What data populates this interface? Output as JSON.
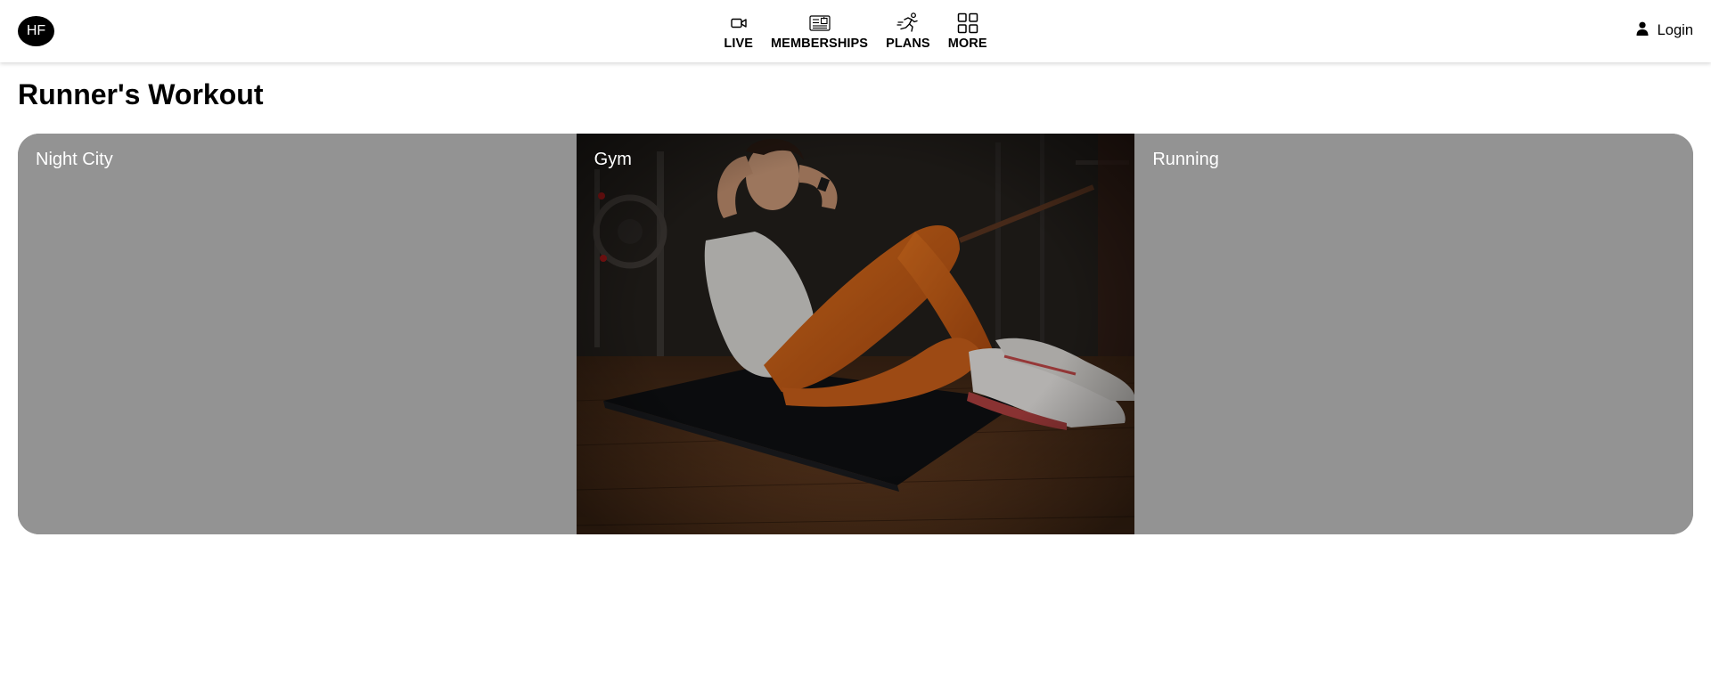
{
  "header": {
    "logo_text": "HF",
    "nav": [
      {
        "label": "LIVE",
        "icon": "video-camera-icon"
      },
      {
        "label": "MEMBERSHIPS",
        "icon": "membership-card-icon"
      },
      {
        "label": "PLANS",
        "icon": "running-person-icon"
      },
      {
        "label": "MORE",
        "icon": "grid-icon"
      }
    ],
    "login_label": "Login",
    "login_icon": "user-icon"
  },
  "page": {
    "title": "Runner's Workout"
  },
  "panels": [
    {
      "label": "Night City",
      "has_image": false
    },
    {
      "label": "Gym",
      "has_image": true,
      "image_description_icon": "gym-photo"
    },
    {
      "label": "Running",
      "has_image": false
    }
  ],
  "colors": {
    "panel_gray": "#939393",
    "logo_bg": "#000000",
    "accent_orange": "#d4601a"
  }
}
